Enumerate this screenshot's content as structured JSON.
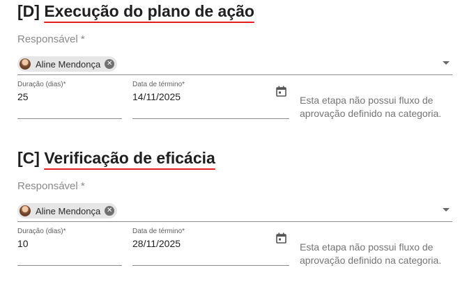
{
  "sections": [
    {
      "tag": "[D]",
      "title": "Execução do plano de ação",
      "responsible_label": "Responsável *",
      "responsible_chip": "Aline Mendonça",
      "duration_label": "Duração (dias)*",
      "duration_value": "25",
      "end_date_label": "Data de término*",
      "end_date_value": "14/11/2025",
      "note": "Esta etapa não possui fluxo de aprovação definido na categoria."
    },
    {
      "tag": "[C]",
      "title": "Verificação de eficácia",
      "responsible_label": "Responsável *",
      "responsible_chip": "Aline Mendonça",
      "duration_label": "Duração (dias)*",
      "duration_value": "10",
      "end_date_label": "Data de término*",
      "end_date_value": "28/11/2025",
      "note": "Esta etapa não possui fluxo de aprovação definido na categoria."
    }
  ],
  "icons": {
    "chip_remove": "close-icon",
    "dropdown": "chevron-down-icon",
    "date_picker": "calendar-icon"
  },
  "colors": {
    "title_underline": "#e11d1d",
    "chip_background": "#e6e6e6"
  }
}
